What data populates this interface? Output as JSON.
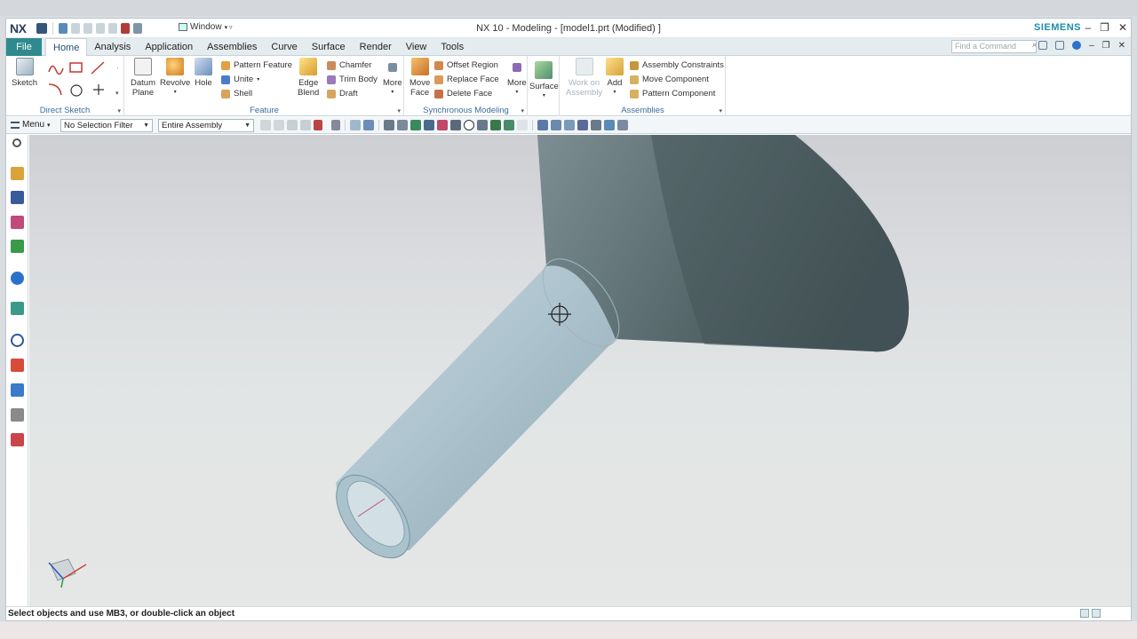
{
  "app": {
    "logo": "NX",
    "title": "NX 10 - Modeling - [model1.prt (Modified) ]",
    "window_menu": "Window",
    "brand": "SIEMENS"
  },
  "menu": {
    "file": "File",
    "tabs": [
      "Home",
      "Analysis",
      "Application",
      "Assemblies",
      "Curve",
      "Surface",
      "Render",
      "View",
      "Tools"
    ],
    "active_tab": "Home",
    "find_command_placeholder": "Find a Command"
  },
  "ribbon": {
    "direct_sketch": {
      "label": "Direct Sketch",
      "sketch": "Sketch"
    },
    "feature": {
      "label": "Feature",
      "datum_plane_1": "Datum",
      "datum_plane_2": "Plane",
      "revolve": "Revolve",
      "hole": "Hole",
      "pattern_feature": "Pattern Feature",
      "unite": "Unite",
      "shell": "Shell",
      "edge_blend_1": "Edge",
      "edge_blend_2": "Blend",
      "chamfer": "Chamfer",
      "trim_body": "Trim Body",
      "draft": "Draft",
      "more": "More"
    },
    "synchronous_modeling": {
      "label": "Synchronous Modeling",
      "move_face_1": "Move",
      "move_face_2": "Face",
      "offset_region": "Offset Region",
      "replace_face": "Replace Face",
      "delete_face": "Delete Face",
      "more": "More"
    },
    "surface": {
      "surface": "Surface"
    },
    "assemblies": {
      "label": "Assemblies",
      "work_on_assembly_1": "Work on",
      "work_on_assembly_2": "Assembly",
      "add": "Add",
      "assembly_constraints": "Assembly Constraints",
      "move_component": "Move Component",
      "pattern_component": "Pattern Component"
    }
  },
  "selection_bar": {
    "menu": "Menu",
    "filter": "No Selection Filter",
    "scope": "Entire Assembly"
  },
  "status": {
    "prompt": "Select objects and use MB3, or double-click an object"
  },
  "colors": {
    "file_tab": "#2f8a8f",
    "brand": "#1a8ea6",
    "cylinder": "#b9cdd6",
    "cone": "#56686c"
  }
}
